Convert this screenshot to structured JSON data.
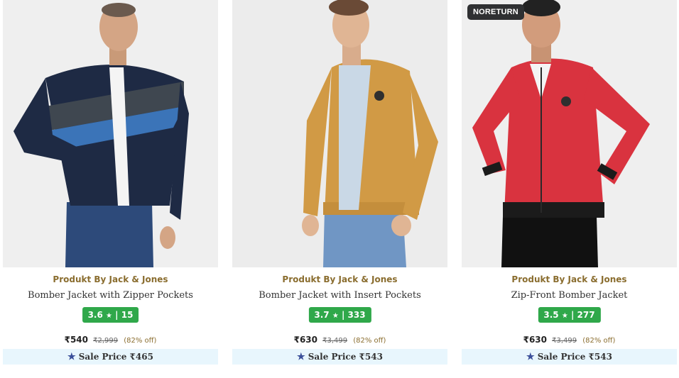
{
  "products": [
    {
      "badge": "",
      "brand": "Produkt By Jack & Jones",
      "name": "Bomber Jacket with Zipper Pockets",
      "rating": "3.6",
      "reviews": "| 15",
      "price": "₹540",
      "mrp": "₹2,999",
      "discount": "(82% off)",
      "sale_price": "Sale Price ₹465"
    },
    {
      "badge": "",
      "brand": "Produkt By Jack & Jones",
      "name": "Bomber Jacket with Insert Pockets",
      "rating": "3.7",
      "reviews": "| 333",
      "price": "₹630",
      "mrp": "₹3,499",
      "discount": "(82% off)",
      "sale_price": "Sale Price ₹543"
    },
    {
      "badge": "NORETURN",
      "brand": "Produkt By Jack & Jones",
      "name": "Zip-Front Bomber Jacket",
      "rating": "3.5",
      "reviews": "| 277",
      "price": "₹630",
      "mrp": "₹3,499",
      "discount": "(82% off)",
      "sale_price": "Sale Price ₹543"
    }
  ],
  "colors": {
    "rating_bg": "#2fa84a",
    "brand_text": "#8a6d2f",
    "sale_bg": "#e8f6fd",
    "badge_bg": "#2f3032"
  },
  "icons": {
    "rating": "star-icon",
    "sale": "star-icon"
  }
}
